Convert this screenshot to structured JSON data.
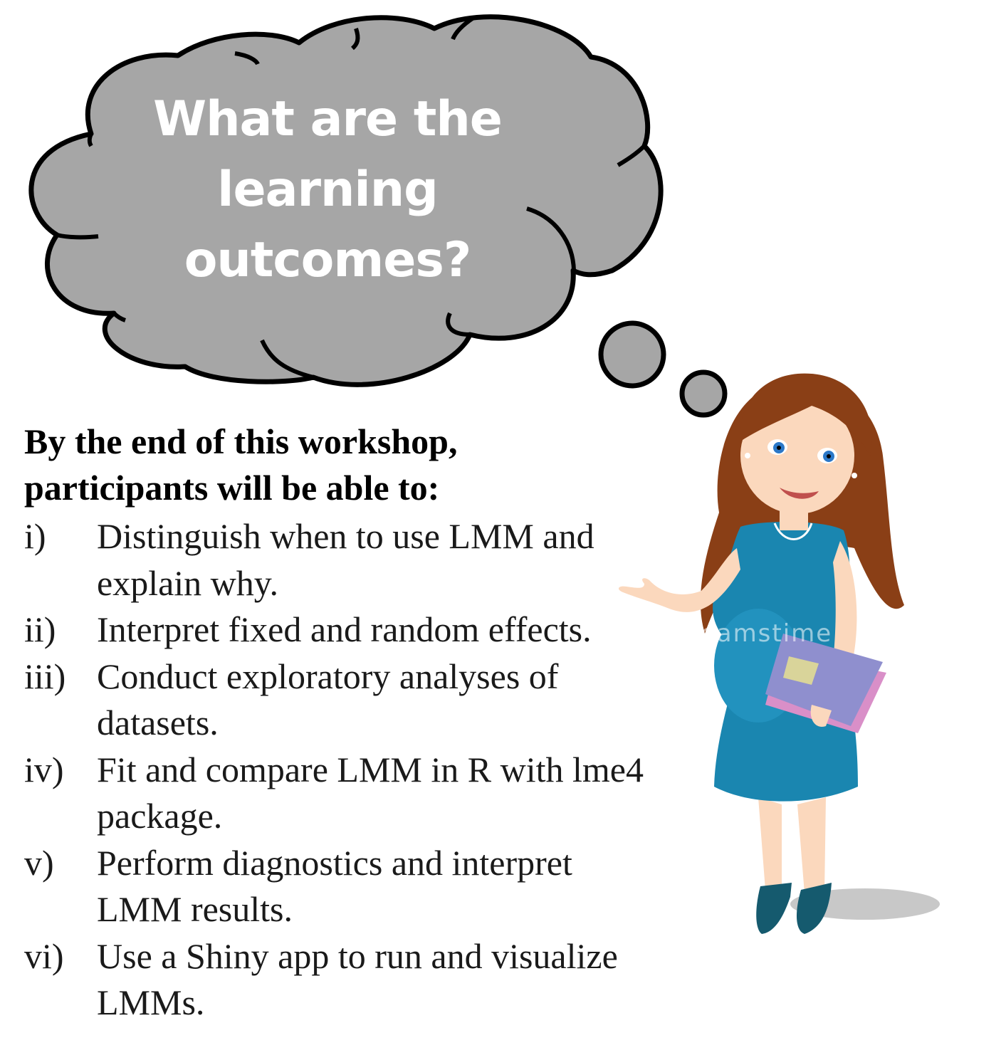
{
  "cloud": {
    "lines": [
      "What are the",
      "learning",
      "outcomes?"
    ]
  },
  "intro": {
    "lines": [
      "By the end of this workshop,",
      "participants will be able to:"
    ]
  },
  "outcomes": [
    {
      "num": "i)",
      "lines": [
        "Distinguish when to use LMM and",
        "explain why."
      ]
    },
    {
      "num": "ii)",
      "lines": [
        "Interpret fixed and random effects."
      ]
    },
    {
      "num": "iii)",
      "lines": [
        "Conduct exploratory analyses of",
        "datasets."
      ]
    },
    {
      "num": "iv)",
      "lines": [
        "Fit and compare LMM in R with lme4",
        "package."
      ]
    },
    {
      "num": "v)",
      "lines": [
        "Perform diagnostics and interpret",
        "LMM results."
      ]
    },
    {
      "num": "vi)",
      "lines": [
        "Use a Shiny app to run and visualize",
        "LMMs."
      ]
    }
  ],
  "watermark": "dreamstime",
  "colors": {
    "cloud_fill": "#a6a6a6",
    "cloud_outline": "#000000",
    "dress": "#1a86b0",
    "hair": "#8a3f16",
    "skin": "#fbd8bd",
    "folder": "#8f8fce"
  }
}
